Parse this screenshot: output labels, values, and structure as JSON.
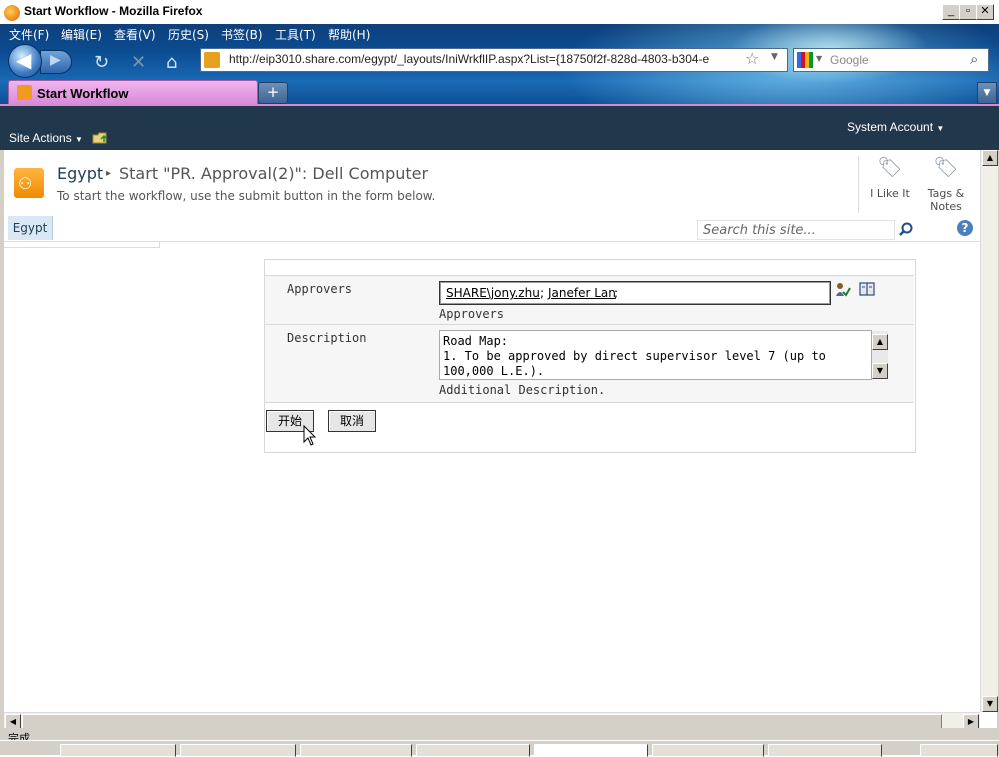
{
  "window": {
    "title": "Start Workflow - Mozilla Firefox"
  },
  "menu": [
    "文件(F)",
    "编辑(E)",
    "查看(V)",
    "历史(S)",
    "书签(B)",
    "工具(T)",
    "帮助(H)"
  ],
  "address": {
    "url": "http://eip3010.share.com/egypt/_layouts/IniWrkflIP.aspx?List={18750f2f-828d-4803-b304-e"
  },
  "search": {
    "placeholder": "Google"
  },
  "tab": {
    "label": "Start Workflow",
    "new_tab": "+"
  },
  "sp": {
    "site_actions": "Site Actions",
    "system_account": "System Account",
    "site_title": "Egypt",
    "page_title": "Start \"PR. Approval(2)\": Dell Computer",
    "description": "To start the workflow, use the submit button in the form below.",
    "i_like_it": "I Like It",
    "tags_notes_1": "Tags &",
    "tags_notes_2": "Notes",
    "nav_home": "Egypt",
    "search_placeholder": "Search this site..."
  },
  "form": {
    "approvers_label": "Approvers",
    "approvers_values": [
      "SHARE\\jony.zhu",
      "Janefer Lan"
    ],
    "approvers_hint": "Approvers",
    "description_label": "Description",
    "description_lines": [
      "Road Map:",
      "1. To be approved by direct supervisor level 7 (up to",
      "100,000 L.E.)."
    ],
    "description_hint": "Additional Description.",
    "start_button": "开始",
    "cancel_button": "取消"
  },
  "status": {
    "text": "完成"
  },
  "colors": {
    "ribbon": "#21374c",
    "tab": "#d889d6",
    "chrome": "#0b4d93"
  }
}
